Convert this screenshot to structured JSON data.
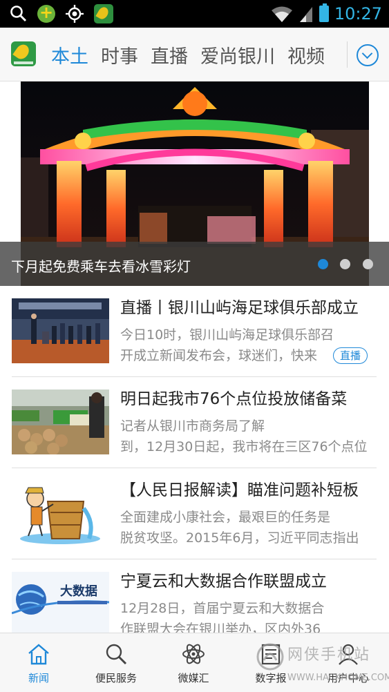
{
  "status_bar": {
    "time": "10:27",
    "icons": [
      "search-icon",
      "app-plus-icon",
      "gps-icon",
      "app-icon",
      "wifi-icon",
      "signal-icon",
      "battery-icon"
    ]
  },
  "header": {
    "tabs": [
      {
        "label": "本土",
        "active": true
      },
      {
        "label": "时事",
        "active": false
      },
      {
        "label": "直播",
        "active": false
      },
      {
        "label": "爱尚银川",
        "active": false
      },
      {
        "label": "视频",
        "active": false
      }
    ],
    "accent_color": "#1e88d8"
  },
  "banner": {
    "caption": "下月起免费乘车去看冰雪彩灯",
    "dots": 3,
    "active_dot": 1
  },
  "news": [
    {
      "title": "直播丨银川山屿海足球俱乐部成立",
      "summary_l1": "今日10时，银川山屿海足球俱乐部召",
      "summary_l2": "开成立新闻发布会，球迷们，快来",
      "badge": "直播"
    },
    {
      "title": "明日起我市76个点位投放储备菜",
      "summary_l1": " 记者从银川市商务局了解",
      "summary_l2": "到，12月30日起，我市将在三区76个点位",
      "badge": ""
    },
    {
      "title": "【人民日报解读】瞄准问题补短板",
      "summary_l1": " 全面建成小康社会，最艰巨的任务是",
      "summary_l2": "脱贫攻坚。2015年6月，习近平同志指出",
      "badge": ""
    },
    {
      "title": "宁夏云和大数据合作联盟成立",
      "summary_l1": " 12月28日，首届宁夏云和大数据合",
      "summary_l2": "作联盟大会在银川举办，区内外36",
      "badge": "",
      "thumb_text": "大数据"
    }
  ],
  "bottom_nav": [
    {
      "label": "新闻",
      "icon": "home-icon",
      "active": true
    },
    {
      "label": "便民服务",
      "icon": "search-icon",
      "active": false
    },
    {
      "label": "微媒汇",
      "icon": "atom-icon",
      "active": false
    },
    {
      "label": "数字报",
      "icon": "newspaper-icon",
      "active": false
    },
    {
      "label": "用户中心",
      "icon": "user-icon",
      "active": false
    }
  ],
  "watermark": {
    "text": "网侠手机站",
    "url": "WWW.HACKHOME.COM"
  }
}
